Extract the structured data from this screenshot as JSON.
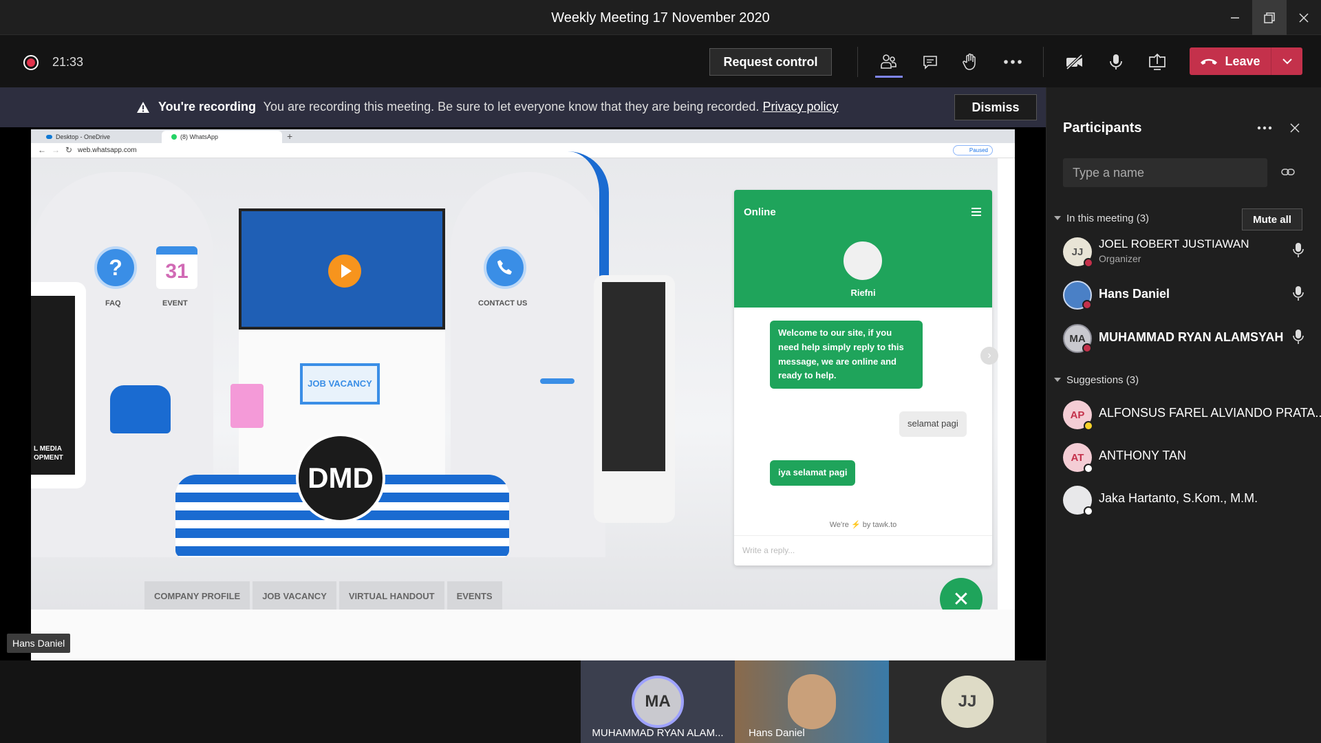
{
  "window": {
    "title": "Weekly Meeting 17 November 2020"
  },
  "toolbar": {
    "timer": "21:33",
    "request_control_label": "Request control",
    "leave_label": "Leave"
  },
  "banner": {
    "title": "You're recording",
    "message": "You are recording this meeting. Be sure to let everyone know that they are being recorded.",
    "link": "Privacy policy",
    "dismiss_label": "Dismiss"
  },
  "shared_screen": {
    "tabs": [
      "Desktop - OneDrive",
      "(8) WhatsApp"
    ],
    "url": "web.whatsapp.com",
    "paused_label": "Paused",
    "scene_labels": {
      "faq": "FAQ",
      "event": "EVENT",
      "contact": "CONTACT US",
      "calendar_day": "31",
      "job_sign": "JOB VACANCY",
      "logo": "DMD",
      "left_panel_text": "L MEDIA\nOPMENT"
    },
    "chat": {
      "status": "Online",
      "agent_name": "Riefni",
      "welcome_message": "Welcome to our site, if you need help simply reply to this message, we are online and ready to help.",
      "user_message": "selamat pagi",
      "agent_reply": "iya selamat pagi",
      "powered_by": "We're ⚡ by tawk.to",
      "reply_placeholder": "Write a reply..."
    },
    "nav_tabs": [
      "COMPANY PROFILE",
      "JOB VACANCY",
      "VIRTUAL HANDOUT",
      "EVENTS"
    ]
  },
  "presenter_tag": "Hans Daniel",
  "video_strip": [
    {
      "initials": "MA",
      "name": "MUHAMMAD RYAN ALAM..."
    },
    {
      "initials": "",
      "name": "Hans Daniel"
    },
    {
      "initials": "JJ",
      "name": ""
    }
  ],
  "participants_panel": {
    "title": "Participants",
    "search_placeholder": "Type a name",
    "in_meeting_label": "In this meeting (3)",
    "mute_all_label": "Mute all",
    "in_meeting": [
      {
        "initials": "JJ",
        "name": "JOEL ROBERT JUSTIAWAN",
        "role": "Organizer"
      },
      {
        "initials": "",
        "name": "Hans Daniel",
        "role": ""
      },
      {
        "initials": "MA",
        "name": "MUHAMMAD RYAN ALAMSYAH",
        "role": ""
      }
    ],
    "suggestions_label": "Suggestions (3)",
    "suggestions": [
      {
        "initials": "AP",
        "name": "ALFONSUS FAREL ALVIANDO PRATA..."
      },
      {
        "initials": "AT",
        "name": "ANTHONY TAN"
      },
      {
        "initials": "",
        "name": "Jaka Hartanto, S.Kom., M.M."
      }
    ]
  },
  "colors": {
    "leave": "#c4314b",
    "banner": "#2d2e3f",
    "chat_green": "#1fa45b",
    "recording": "#e0324b"
  }
}
